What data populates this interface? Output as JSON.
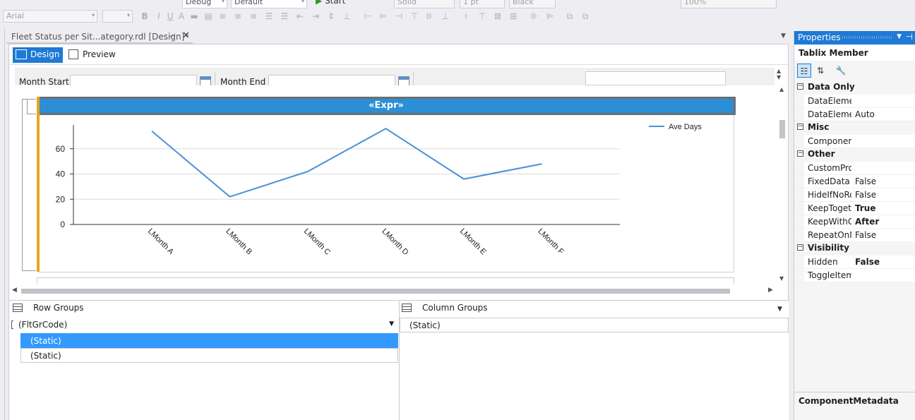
{
  "toolbar": {
    "font_name": "Arial",
    "font_size": "",
    "config": "Debug",
    "platform": "Default",
    "start_label": "Start",
    "line_style": "Solid",
    "line_width": "1 pt",
    "color": "Black",
    "zoom": "100%"
  },
  "document_tab": {
    "title": "Fleet Status per Sit...ategory.rdl [Design]*",
    "pin_glyph": "⊣",
    "close_glyph": "✕"
  },
  "view_modes": {
    "design_label": "Design",
    "preview_label": "Preview"
  },
  "parameters": {
    "month_start_label": "Month Start",
    "month_end_label": "Month End"
  },
  "tablix": {
    "header_expr": "«Expr»"
  },
  "chart_data": {
    "type": "line",
    "categories": [
      "LMonth A",
      "LMonth B",
      "LMonth C",
      "LMonth D",
      "LMonth E",
      "LMonth F"
    ],
    "series": [
      {
        "name": "Ave Days",
        "values": [
          74,
          22,
          42,
          76,
          36,
          48
        ],
        "color": "#4a90d9"
      }
    ],
    "ylim": [
      0,
      80
    ],
    "yticks": [
      0,
      20,
      40,
      60
    ],
    "grid": true,
    "legend_position": "top-right"
  },
  "groups": {
    "row_groups_label": "Row Groups",
    "column_groups_label": "Column Groups",
    "row_items": [
      "(FltGrCode)",
      "(Static)",
      "(Static)"
    ],
    "column_items": [
      "(Static)"
    ]
  },
  "properties": {
    "title": "Properties",
    "object_name": "Tablix Member",
    "categories": [
      {
        "name": "Data Only",
        "rows": [
          {
            "name": "DataElementName",
            "value": ""
          },
          {
            "name": "DataElementOutput",
            "value": "Auto",
            "bold": false
          }
        ]
      },
      {
        "name": "Misc",
        "rows": [
          {
            "name": "ComponentMetadata",
            "value": ""
          }
        ]
      },
      {
        "name": "Other",
        "rows": [
          {
            "name": "CustomProperties",
            "value": ""
          },
          {
            "name": "FixedData",
            "value": "False",
            "bold": false
          },
          {
            "name": "HideIfNoRows",
            "value": "False",
            "bold": false
          },
          {
            "name": "KeepTogether",
            "value": "True",
            "bold": true
          },
          {
            "name": "KeepWithGroup",
            "value": "After",
            "bold": true
          },
          {
            "name": "RepeatOnNewPage",
            "value": "False",
            "bold": false
          }
        ]
      },
      {
        "name": "Visibility",
        "rows": [
          {
            "name": "Hidden",
            "value": "False",
            "bold": true
          },
          {
            "name": "ToggleItem",
            "value": ""
          }
        ]
      }
    ],
    "description_title": "ComponentMetadata"
  }
}
